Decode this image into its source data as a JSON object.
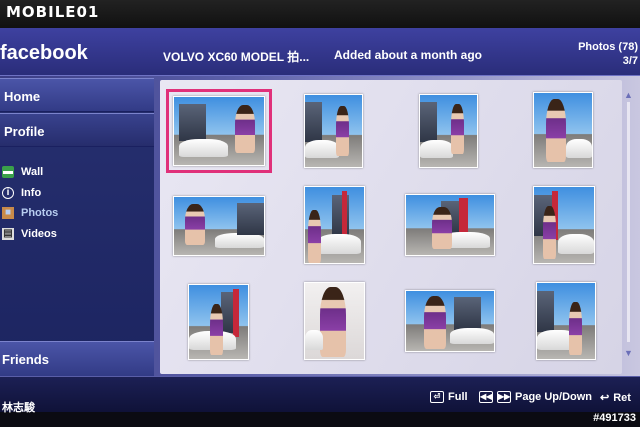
{
  "watermark_logo": "MOBILE01",
  "header": {
    "brand": "facebook",
    "album_title": "VOLVO XC60 MODEL 拍...",
    "added": "Added about a month ago",
    "photos_label": "Photos (78)",
    "page_indicator": "3/7"
  },
  "sidebar": {
    "home": "Home",
    "profile": "Profile",
    "items": [
      {
        "label": "Wall",
        "icon": "wall-icon"
      },
      {
        "label": "Info",
        "icon": "info-icon"
      },
      {
        "label": "Photos",
        "icon": "photos-icon",
        "active": true
      },
      {
        "label": "Videos",
        "icon": "videos-icon"
      }
    ],
    "friends": "Friends"
  },
  "user": {
    "name": "林志駿"
  },
  "controls": {
    "full": "Full",
    "page": "Page Up/Down",
    "ret": "Ret"
  },
  "photo_id": "#491733"
}
